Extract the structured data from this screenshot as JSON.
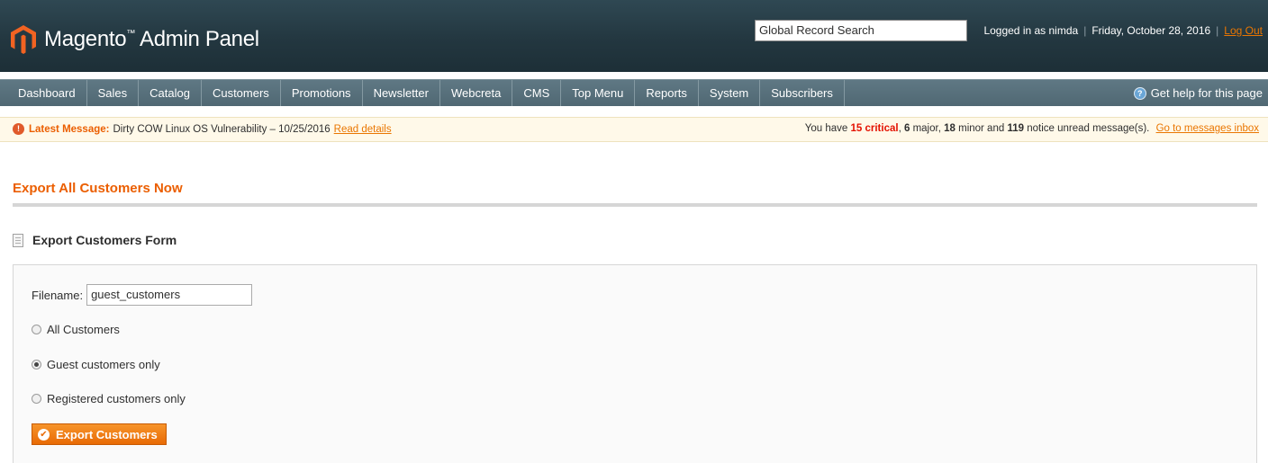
{
  "header": {
    "app_name": "Magento",
    "trademark": "™",
    "app_suffix": "Admin Panel",
    "search_value": "Global Record Search",
    "logged_in_text": "Logged in as nimda",
    "date_text": "Friday, October 28, 2016",
    "logout_label": "Log Out"
  },
  "nav": {
    "items": [
      {
        "label": "Dashboard"
      },
      {
        "label": "Sales"
      },
      {
        "label": "Catalog"
      },
      {
        "label": "Customers"
      },
      {
        "label": "Promotions"
      },
      {
        "label": "Newsletter"
      },
      {
        "label": "Webcreta"
      },
      {
        "label": "CMS"
      },
      {
        "label": "Top Menu"
      },
      {
        "label": "Reports"
      },
      {
        "label": "System"
      },
      {
        "label": "Subscribers"
      }
    ],
    "help_label": "Get help for this page"
  },
  "message_bar": {
    "label": "Latest Message:",
    "text": "Dirty COW Linux OS Vulnerability – 10/25/2016",
    "link": "Read details",
    "summary_prefix": "You have",
    "critical_count": "15 critical",
    "major_count": "6",
    "major_label": "major,",
    "minor_count": "18",
    "minor_label": "minor and",
    "notice_count": "119",
    "notice_label": "notice unread message(s).",
    "inbox_link": "Go to messages inbox"
  },
  "main": {
    "page_title": "Export All Customers Now",
    "form_title": "Export Customers Form",
    "filename_label": "Filename:",
    "filename_value": "guest_customers",
    "options": [
      {
        "label": "All Customers",
        "checked": false
      },
      {
        "label": "Guest customers only",
        "checked": true
      },
      {
        "label": "Registered customers only",
        "checked": false
      }
    ],
    "export_button": "Export Customers"
  },
  "colors": {
    "accent": "#eb5e00",
    "header_bg": "#233740",
    "nav_bg": "#566f7b",
    "message_bg": "#fff9e9",
    "critical": "#e41101"
  }
}
